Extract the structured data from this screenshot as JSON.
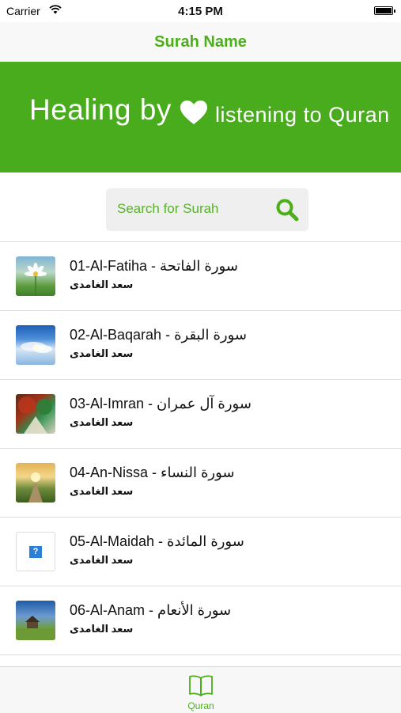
{
  "status_bar": {
    "carrier": "Carrier",
    "time": "4:15 PM"
  },
  "navbar": {
    "title": "Surah Name"
  },
  "banner": {
    "left_text": "Healing by",
    "right_text": "listening to Quran"
  },
  "search": {
    "placeholder": "Search for Surah"
  },
  "surahs": [
    {
      "title": "01-Al-Fatiha - سورة الفاتحة",
      "reciter": "سعد الغامدى",
      "thumb": "flower-photo"
    },
    {
      "title": "02-Al-Baqarah - سورة البقرة",
      "reciter": "سعد الغامدى",
      "thumb": "sky-photo"
    },
    {
      "title": "03-Al-Imran - سورة آل عمران",
      "reciter": "سعد الغامدى",
      "thumb": "autumn-path-photo"
    },
    {
      "title": "04-An-Nissa -  سورة النساء",
      "reciter": "سعد الغامدى",
      "thumb": "sunset-path-photo"
    },
    {
      "title": "05-Al-Maidah - سورة المائدة",
      "reciter": "سعد الغامدى",
      "thumb": "missing-image"
    },
    {
      "title": "06-Al-Anam - سورة الأنعام",
      "reciter": "سعد الغامدى",
      "thumb": "cabin-field-photo"
    }
  ],
  "tabbar": {
    "tabs": [
      {
        "label": "Quran",
        "icon": "open-book-icon"
      }
    ]
  },
  "colors": {
    "accent": "#4caf1a",
    "banner": "#48ac1c"
  }
}
